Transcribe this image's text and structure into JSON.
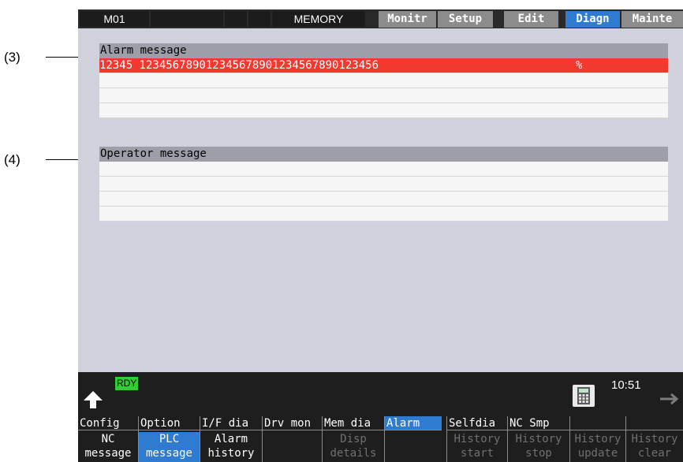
{
  "callouts": [
    "(3)",
    "(4)"
  ],
  "topbar": {
    "mode": "M01",
    "status": "MEMORY",
    "tabs": [
      "Monitr",
      "Setup",
      "Edit",
      "Diagn",
      "Mainte"
    ],
    "active_tab": "Diagn"
  },
  "alarm_panel": {
    "title": "Alarm message",
    "rows": [
      {
        "text": "12345 123456789012345678901234567890123456",
        "suffix": "%"
      }
    ]
  },
  "operator_panel": {
    "title": "Operator message"
  },
  "status": {
    "rdy": "RDY",
    "time": "10:51"
  },
  "menu": [
    {
      "label": "Config",
      "selected": false
    },
    {
      "label": "Option",
      "selected": false
    },
    {
      "label": "I/F dia",
      "selected": false
    },
    {
      "label": "Drv mon",
      "selected": false
    },
    {
      "label": "Mem dia",
      "selected": false
    },
    {
      "label": "Alarm",
      "selected": true
    },
    {
      "label": "Selfdia",
      "selected": false
    },
    {
      "label": "NC Smp",
      "selected": false
    }
  ],
  "subkeys": [
    {
      "line1": "NC",
      "line2": "message",
      "state": "normal"
    },
    {
      "line1": "PLC",
      "line2": "message",
      "state": "selected"
    },
    {
      "line1": "Alarm",
      "line2": "history",
      "state": "normal"
    },
    {
      "line1": "",
      "line2": "",
      "state": "normal"
    },
    {
      "line1": "Disp",
      "line2": "details",
      "state": "dim"
    },
    {
      "line1": "",
      "line2": "",
      "state": "normal"
    },
    {
      "line1": "History",
      "line2": "start",
      "state": "dim"
    },
    {
      "line1": "History",
      "line2": "stop",
      "state": "dim"
    },
    {
      "line1": "History",
      "line2": "update",
      "state": "dim"
    },
    {
      "line1": "History",
      "line2": "clear",
      "state": "dim"
    }
  ]
}
